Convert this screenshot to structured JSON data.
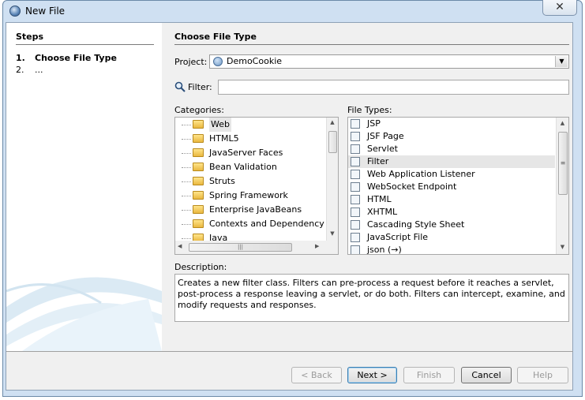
{
  "window": {
    "title": "New File",
    "close_label": "✕"
  },
  "steps": {
    "title": "Steps",
    "items": [
      {
        "num": "1.",
        "label": "Choose File Type",
        "current": true
      },
      {
        "num": "2.",
        "label": "...",
        "current": false
      }
    ]
  },
  "main": {
    "heading": "Choose File Type",
    "project_label": "Project:",
    "project_value": "DemoCookie",
    "filter_label": "Filter:",
    "filter_value": "",
    "categories_label": "Categories:",
    "categories": [
      "Web",
      "HTML5",
      "JavaServer Faces",
      "Bean Validation",
      "Struts",
      "Spring Framework",
      "Enterprise JavaBeans",
      "Contexts and Dependency Inje",
      "Java"
    ],
    "selected_category": "Web",
    "file_types_label": "File Types:",
    "file_types": [
      "JSP",
      "JSF Page",
      "Servlet",
      "Filter",
      "Web Application Listener",
      "WebSocket Endpoint",
      "HTML",
      "XHTML",
      "Cascading Style Sheet",
      "JavaScript File",
      "json (→)"
    ],
    "selected_file_type": "Filter",
    "description_label": "Description:",
    "description": "Creates a new filter class. Filters can pre-process a request before it reaches a servlet, post-process a response leaving a servlet, or do both. Filters can intercept, examine, and modify requests and responses."
  },
  "buttons": {
    "back": "< Back",
    "next": "Next >",
    "finish": "Finish",
    "cancel": "Cancel",
    "help": "Help"
  },
  "colors": {
    "accent": "#3c7fb1",
    "frame": "#cfe0f2"
  }
}
